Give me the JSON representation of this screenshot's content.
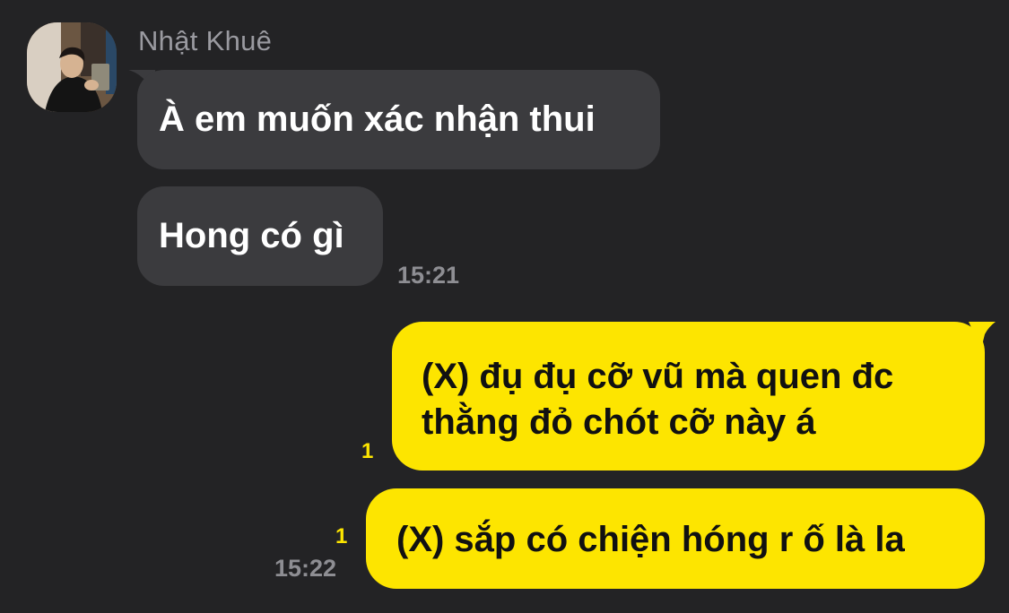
{
  "chat": {
    "background_color": "#232325",
    "incoming_bubble_color": "#3b3b3e",
    "outgoing_bubble_color": "#fde500",
    "sender": {
      "name": "Nhật Khuê",
      "avatar_icon": "profile-photo"
    },
    "messages": [
      {
        "direction": "incoming",
        "text": "À em muốn xác nhận thui"
      },
      {
        "direction": "incoming",
        "text": "Hong có gì",
        "time": "15:21"
      },
      {
        "direction": "outgoing",
        "lines": [
          "(X) đụ đụ cỡ vũ mà quen đc",
          "thằng đỏ chót cỡ này á"
        ],
        "unread": "1"
      },
      {
        "direction": "outgoing",
        "text": "(X) sắp có chiện hóng r ố là la",
        "unread": "1",
        "time": "15:22"
      }
    ]
  }
}
